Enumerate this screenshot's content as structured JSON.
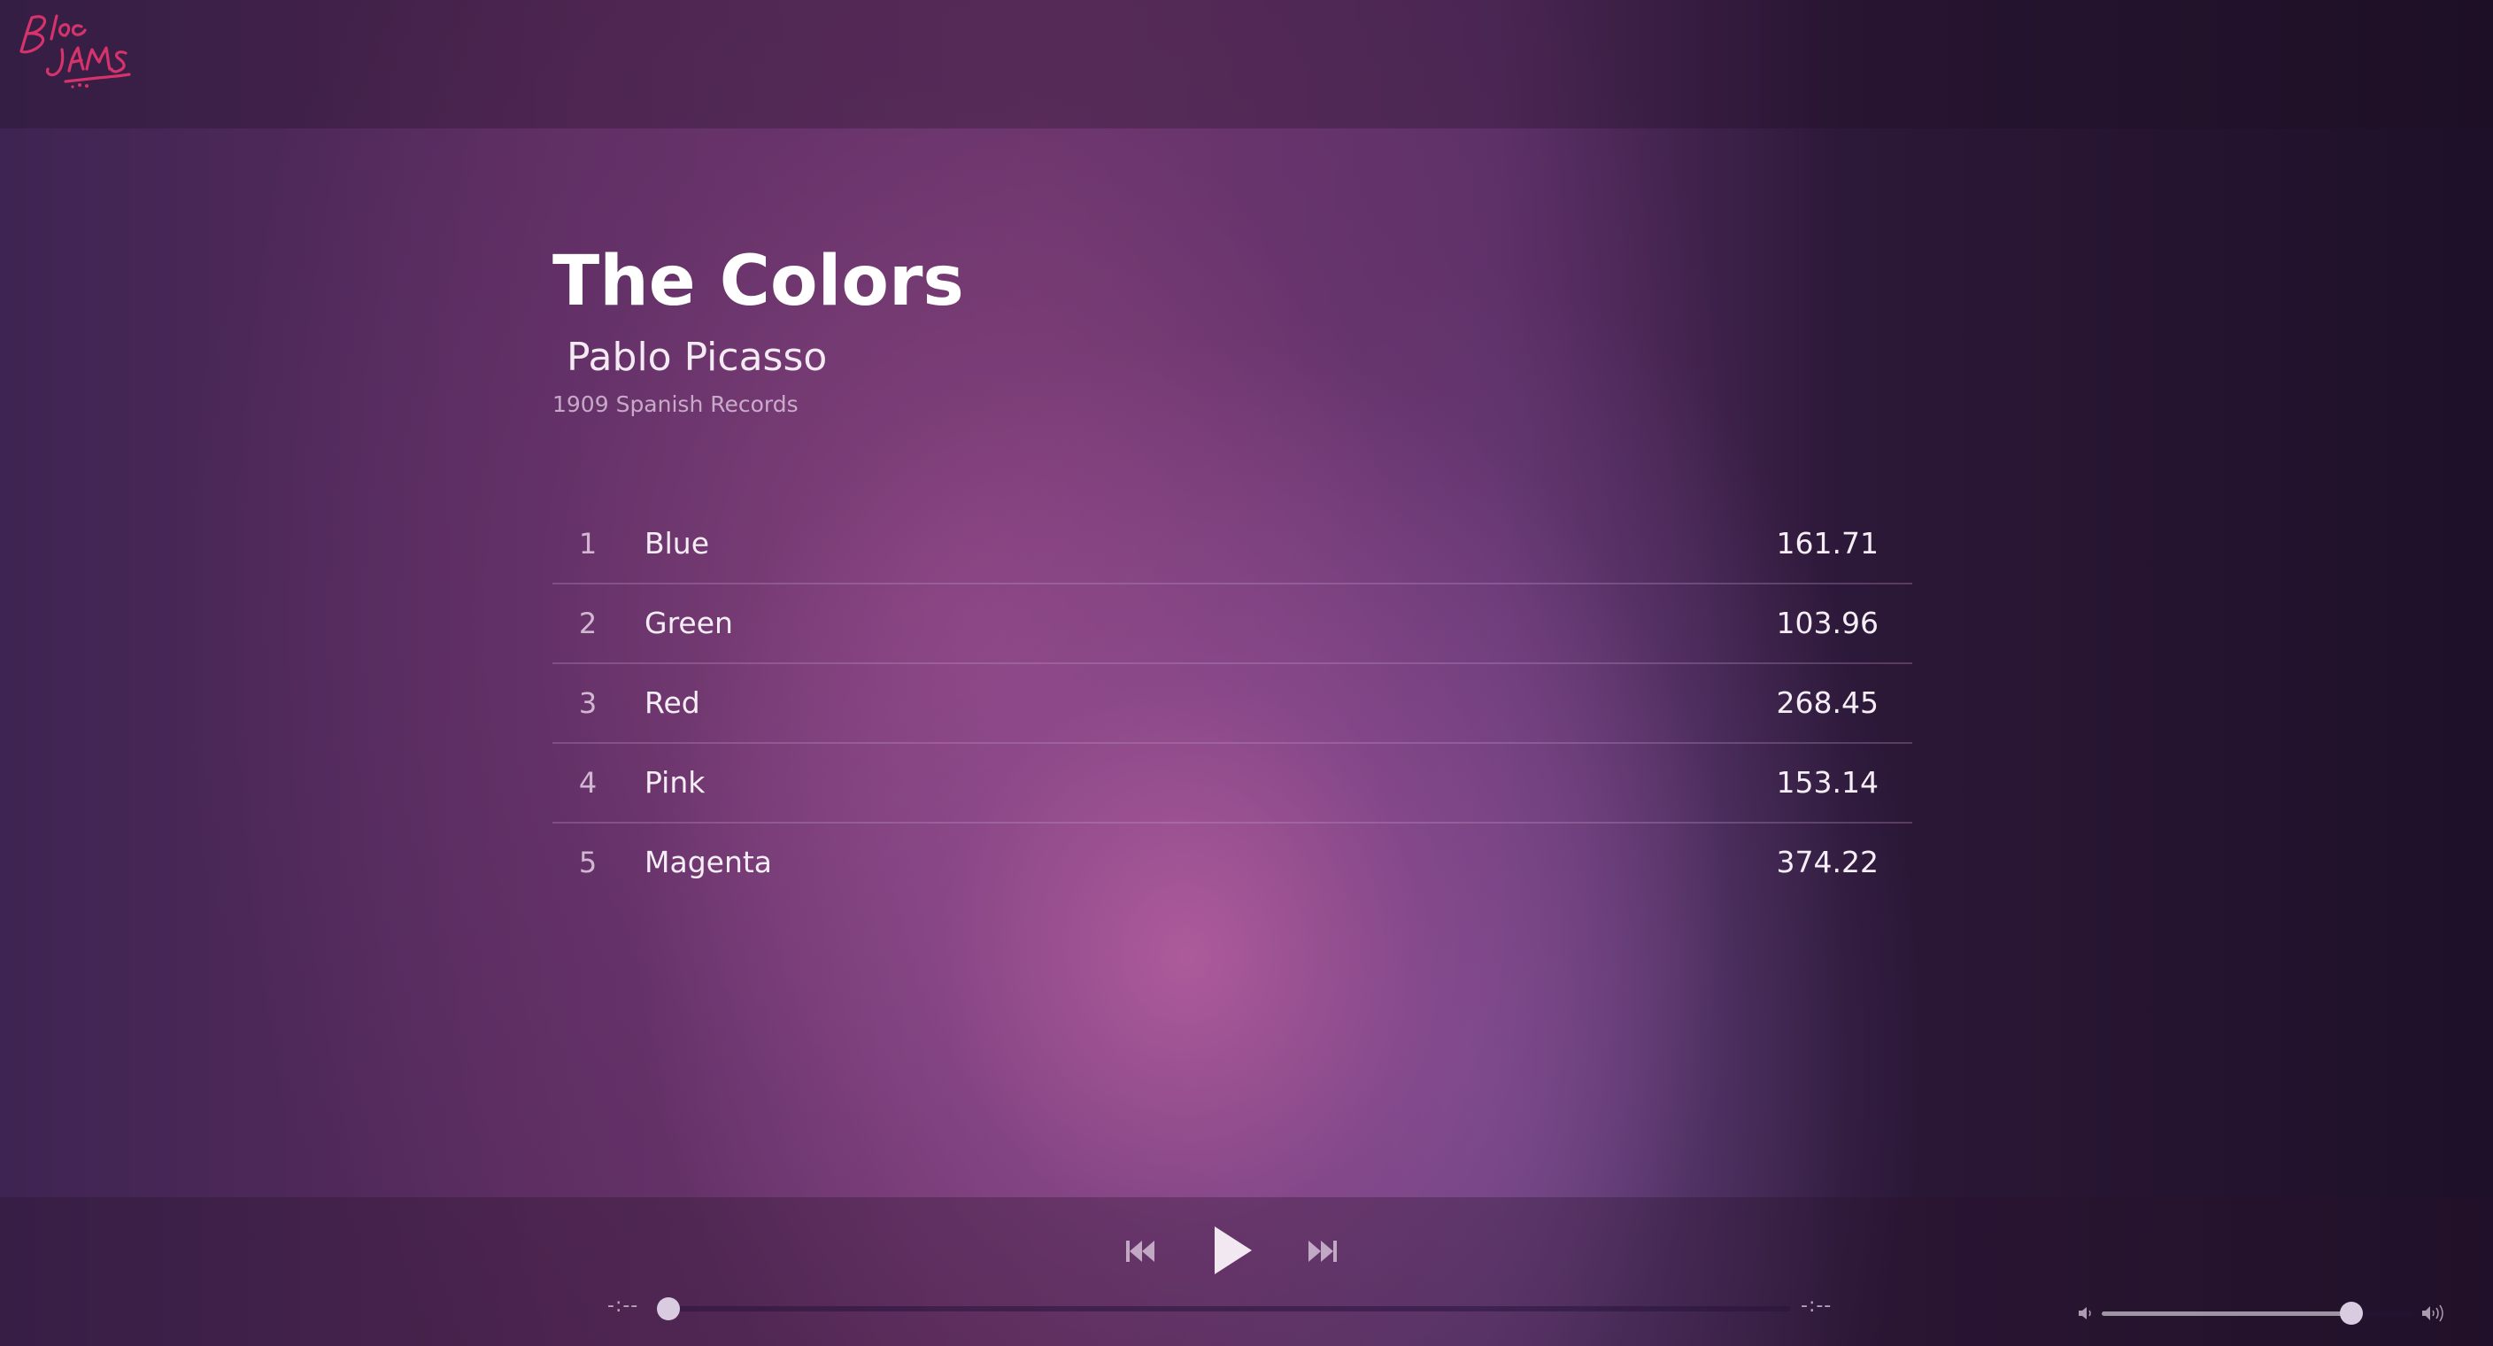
{
  "logo": {
    "alt": "Bloc Jams",
    "color": "#d6336c"
  },
  "album": {
    "title": "The Colors",
    "artist": "Pablo Picasso",
    "release_info": "1909 Spanish Records"
  },
  "songs": [
    {
      "number": "1",
      "title": "Blue",
      "duration": "161.71"
    },
    {
      "number": "2",
      "title": "Green",
      "duration": "103.96"
    },
    {
      "number": "3",
      "title": "Red",
      "duration": "268.45"
    },
    {
      "number": "4",
      "title": "Pink",
      "duration": "153.14"
    },
    {
      "number": "5",
      "title": "Magenta",
      "duration": "374.22"
    }
  ],
  "player": {
    "current_time": "-:--",
    "total_time": "-:--",
    "seek_progress": 0,
    "volume_level": 0.8,
    "icons": {
      "previous": "skip-previous-icon",
      "play": "play-icon",
      "next": "skip-next-icon",
      "volume_low": "volume-low-icon",
      "volume_high": "volume-high-icon"
    }
  }
}
